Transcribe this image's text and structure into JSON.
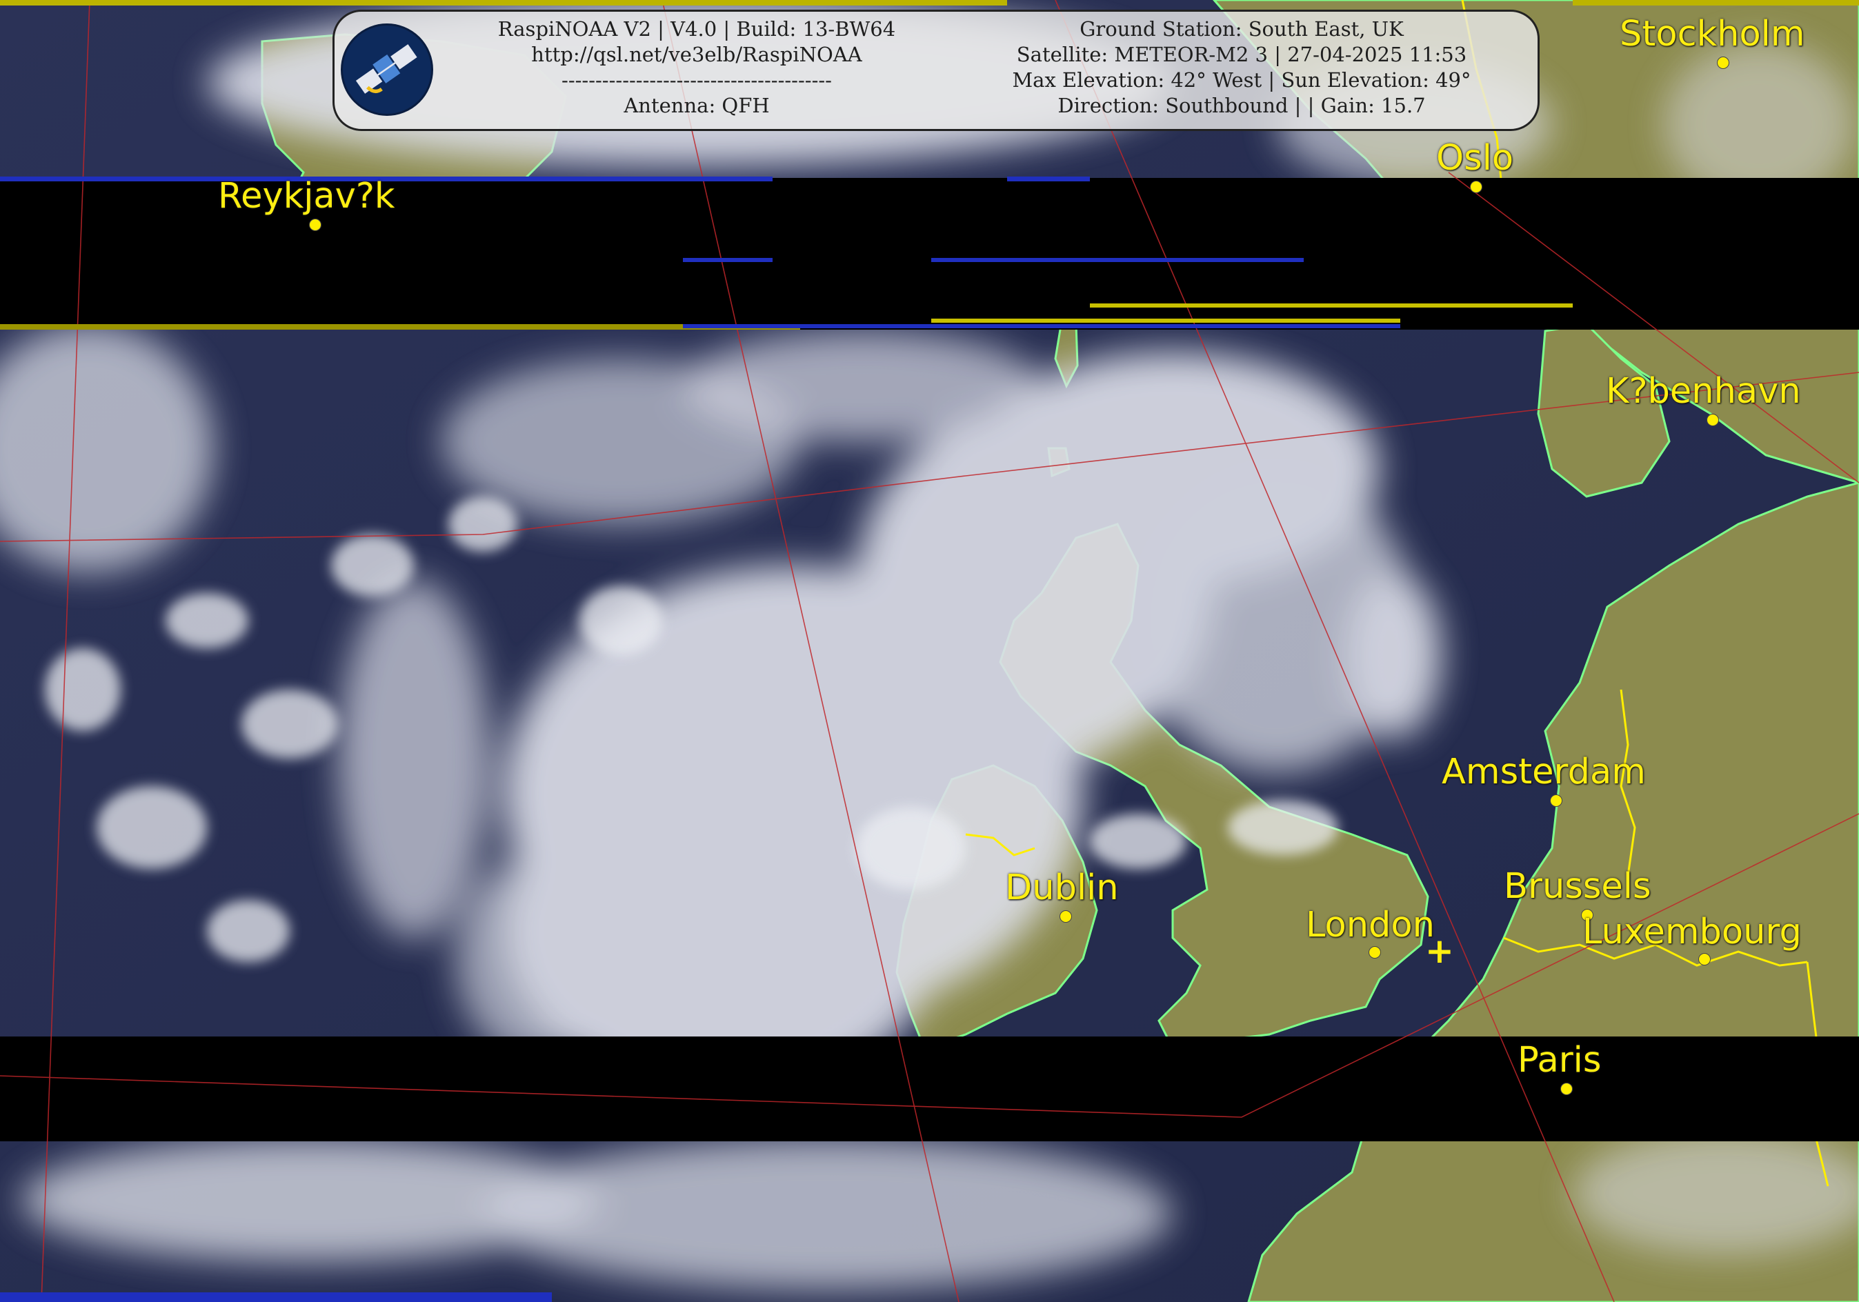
{
  "header": {
    "left_lines": [
      "RaspiNOAA V2 | V4.0 | Build: 13-BW64",
      "http://qsl.net/ve3elb/RaspiNOAA",
      "----------------------------------------",
      "Antenna: QFH"
    ],
    "right_lines": [
      "Ground Station: South East, UK",
      "Satellite: METEOR-M2 3 | 27-04-2025 11:53",
      "Max Elevation: 42° West | Sun Elevation: 49°",
      "Direction: Southbound | | Gain: 15.7"
    ],
    "logo_icon": "satellite-icon"
  },
  "cities": [
    {
      "id": "stockholm",
      "name": "Stockholm"
    },
    {
      "id": "oslo",
      "name": "Oslo"
    },
    {
      "id": "reykjavik",
      "name": "Reykjav?k"
    },
    {
      "id": "kobenhavn",
      "name": "K?benhavn"
    },
    {
      "id": "amsterdam",
      "name": "Amsterdam"
    },
    {
      "id": "dublin",
      "name": "Dublin"
    },
    {
      "id": "brussels",
      "name": "Brussels"
    },
    {
      "id": "london",
      "name": "London"
    },
    {
      "id": "luxembourg",
      "name": "Luxembourg"
    },
    {
      "id": "paris",
      "name": "Paris"
    }
  ],
  "station_marker_icon": "plus-icon",
  "colors": {
    "city_label": "#ffee11",
    "coastline": "#7dff8a",
    "border": "#ffee00",
    "graticule": "#c0262a",
    "land": "#8c8b4e",
    "sea": "#2a3356"
  }
}
